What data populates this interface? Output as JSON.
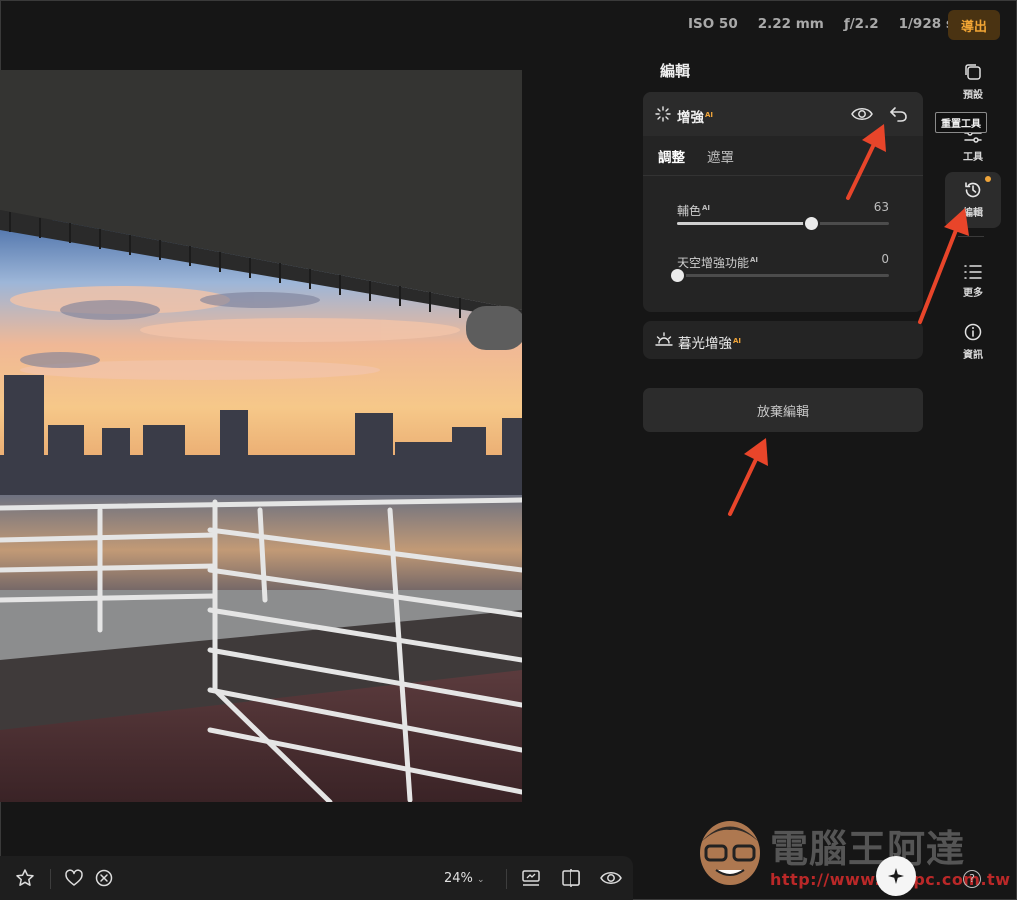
{
  "header": {
    "iso": "ISO 50",
    "focal": "2.22 mm",
    "aperture": "ƒ/2.2",
    "shutter": "1/928 s",
    "export_label": "導出"
  },
  "panel": {
    "title": "編輯",
    "enhance": {
      "title": "增強",
      "ai_badge": "AI",
      "tabs": [
        "調整",
        "遮罩"
      ],
      "sliders": [
        {
          "label": "輔色",
          "ai": "AI",
          "value": "63",
          "fraction": 0.63
        },
        {
          "label": "天空增強功能",
          "ai": "AI",
          "value": "0",
          "fraction": 0.0
        }
      ]
    },
    "twilight": {
      "title": "暮光增強",
      "ai_badge": "AI"
    },
    "discard_label": "放棄編輯"
  },
  "rail": {
    "presets": "預設",
    "tools": "工具",
    "edits": "編輯",
    "more": "更多",
    "info": "資訊",
    "tooltip": "重置工具"
  },
  "toolbar": {
    "zoom": "24%"
  },
  "watermark": {
    "logo_text": "電腦王阿達",
    "url": "http://www.kocpc.com.tw"
  },
  "colors": {
    "accent": "#f0a53a",
    "arrow": "#e8452a",
    "background": "#161616"
  }
}
